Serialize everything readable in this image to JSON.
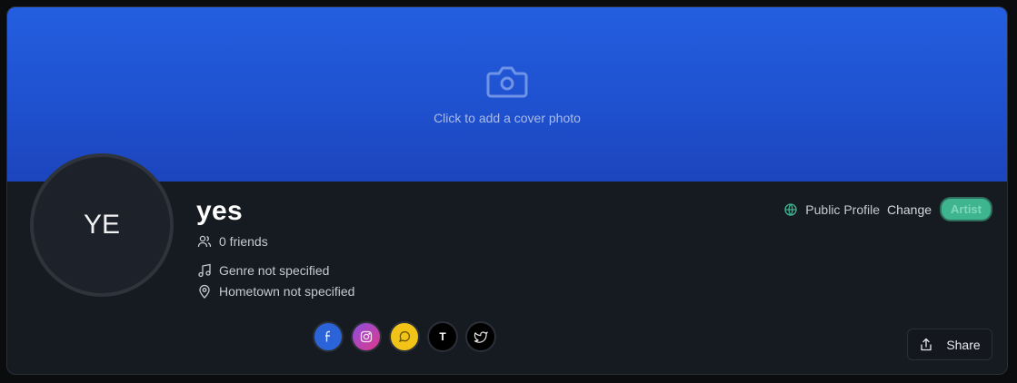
{
  "cover": {
    "prompt": "Click to add a cover photo",
    "icon": "camera-icon",
    "gradient": [
      "#235fe0",
      "#1c45bd"
    ]
  },
  "profile": {
    "initials": "YE",
    "name": "yes",
    "friends": "0 friends",
    "genre": "Genre not specified",
    "hometown": "Hometown not specified"
  },
  "visibility": {
    "label": "Public Profile",
    "change_label": "Change",
    "badge": "Artist",
    "badge_color": "#3fb58f"
  },
  "socials": [
    {
      "name": "facebook",
      "icon": "facebook-icon",
      "color": "#2b63d9"
    },
    {
      "name": "instagram",
      "icon": "instagram-icon",
      "color": "#c23ab8"
    },
    {
      "name": "chat",
      "icon": "chat-bubble-icon",
      "color": "#f2c418"
    },
    {
      "name": "tiktok",
      "icon": "tiktok-icon",
      "label": "T",
      "color": "#000000"
    },
    {
      "name": "twitter",
      "icon": "twitter-icon",
      "color": "#000000"
    }
  ],
  "actions": {
    "share_label": "Share"
  }
}
